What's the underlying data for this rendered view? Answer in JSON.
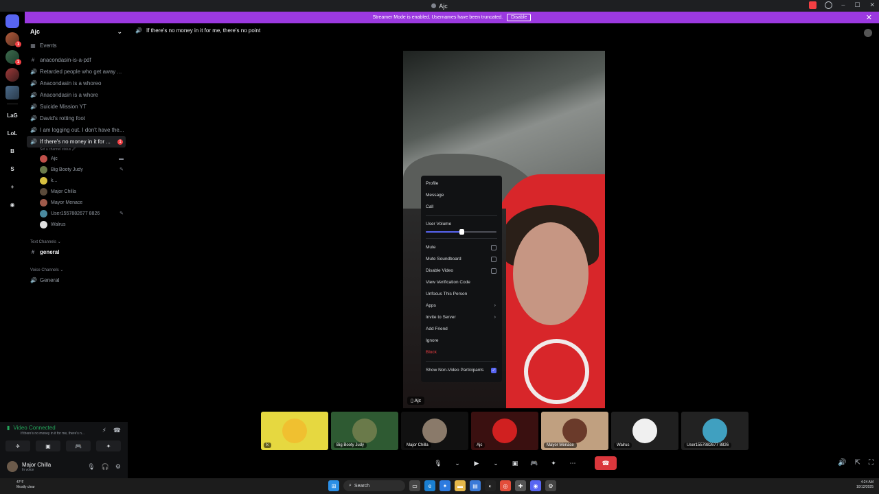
{
  "window": {
    "title": "Ajc",
    "minimize": "–",
    "maximize": "☐",
    "close": "✕"
  },
  "banner": {
    "text": "Streamer Mode is enabled. Usernames have been truncated.",
    "disable_label": "Disable",
    "close": "✕"
  },
  "rail": {
    "servers": [
      {
        "name": "discord-home",
        "label": "",
        "style": "home"
      },
      {
        "name": "server-1",
        "label": "",
        "style": "img1",
        "ping": "1"
      },
      {
        "name": "server-2",
        "label": "",
        "style": "img2",
        "ping": "1"
      },
      {
        "name": "server-3",
        "label": "",
        "style": "img3"
      },
      {
        "name": "server-4",
        "label": "",
        "style": "img4"
      },
      {
        "name": "server-lag",
        "label": "LaG",
        "style": "txt"
      },
      {
        "name": "server-lol",
        "label": "LoL",
        "style": "txt"
      },
      {
        "name": "server-b",
        "label": "B",
        "style": "txt"
      },
      {
        "name": "server-s",
        "label": "S",
        "style": "txt"
      },
      {
        "name": "add-server",
        "label": "+",
        "style": "txt"
      },
      {
        "name": "discover",
        "label": "◉",
        "style": "txt"
      }
    ]
  },
  "sidebar": {
    "server_name": "Ajc",
    "chevron": "⌄",
    "events_label": "Events",
    "channels": [
      {
        "icon": "#",
        "label": "anacondasin-is-a-pdf"
      },
      {
        "icon": "🔊",
        "label": "Retarded people who get away ..."
      },
      {
        "icon": "🔊",
        "label": "Anacondasin is a whoreo"
      },
      {
        "icon": "🔊",
        "label": "Anacondasin is a whore"
      },
      {
        "icon": "🔊",
        "label": "Suicide Mission YT"
      },
      {
        "icon": "🔊",
        "label": "David's rotting foot"
      },
      {
        "icon": "🔊",
        "label": "I am logging out. I don't have the..."
      }
    ],
    "active_channel": {
      "icon": "🔊",
      "label": "If there's no money in it for ...",
      "badge": "1",
      "status": "Set a channel status 🖉"
    },
    "members": [
      {
        "name": "Ajc",
        "color": "#c0504a",
        "icon": "▬"
      },
      {
        "name": "Big Booty Judy",
        "color": "#6a7a4a",
        "icon": "✎"
      },
      {
        "name": "k...",
        "color": "#d8c040",
        "icon": ""
      },
      {
        "name": "Major Chilla",
        "color": "#5a4a3a",
        "icon": ""
      },
      {
        "name": "Mayor Menace",
        "color": "#a05a4a",
        "icon": ""
      },
      {
        "name": "User1557882677 8826",
        "color": "#4a8aa0",
        "icon": "✎"
      },
      {
        "name": "Walrus",
        "color": "#e0e0e0",
        "icon": ""
      }
    ],
    "text_category": "Text Channels ⌄",
    "text_channel": "general",
    "voice_category": "Voice Channels ⌄",
    "voice_channel": "General"
  },
  "voice": {
    "status": "Video Connected",
    "sub": "If there's no money in it for me, there's n...",
    "btn_labels": [
      "✈",
      "▣",
      "🎮",
      "✦"
    ]
  },
  "user": {
    "name": "Major Chilla",
    "status": "In voice"
  },
  "stage": {
    "title": "If there's no money in it for me, there's no point",
    "main_label": "Ajc"
  },
  "context_menu": {
    "profile": "Profile",
    "message": "Message",
    "call": "Call",
    "volume_label": "User Volume",
    "volume": 0.5,
    "mute": "Mute",
    "mute_soundboard": "Mute Soundboard",
    "disable_video": "Disable Video",
    "view_verification": "View Verification Code",
    "unfocus": "Unfocus This Person",
    "apps": "Apps",
    "invite": "Invite to Server",
    "add_friend": "Add Friend",
    "ignore": "Ignore",
    "block": "Block",
    "show_non_video": "Show Non-Video Participants",
    "checkmark": "✓",
    "arrow": "›"
  },
  "thumbnails": [
    {
      "label": "k",
      "bg": "#e6d840",
      "av": "#f0c030",
      "name": "thumb-k"
    },
    {
      "label": "Big Booty Judy",
      "bg": "#2e5a32",
      "av": "#6a7a4a",
      "name": "thumb-big-booty-judy"
    },
    {
      "label": "Major Chilla",
      "bg": "#111111",
      "av": "#8a7a6a",
      "name": "thumb-major-chilla"
    },
    {
      "label": "Ajc",
      "bg": "#3a1010",
      "av": "#d02020",
      "name": "thumb-ajc"
    },
    {
      "label": "Mayor Menace",
      "bg": "#c0a080",
      "av": "#6a3a2a",
      "name": "thumb-mayor-menace"
    },
    {
      "label": "Walrus",
      "bg": "#202020",
      "av": "#f0f0f0",
      "name": "thumb-walrus"
    },
    {
      "label": "User1557882677 8826",
      "bg": "#222222",
      "av": "#40a0c0",
      "name": "thumb-user"
    }
  ],
  "call_controls": {
    "mic": "🎙",
    "dropdown": "⌄",
    "camera": "▶",
    "screen": "▣",
    "activity": "🎮",
    "soundboard": "✦",
    "more": "⋯",
    "end": "☎",
    "volume": "🔊",
    "popout": "⇱",
    "fullscreen": "⛶"
  },
  "taskbar": {
    "temp": "47°F",
    "weather": "Mostly clear",
    "search": "Search",
    "time": "4:24 AM",
    "date": "10/12/2025"
  }
}
